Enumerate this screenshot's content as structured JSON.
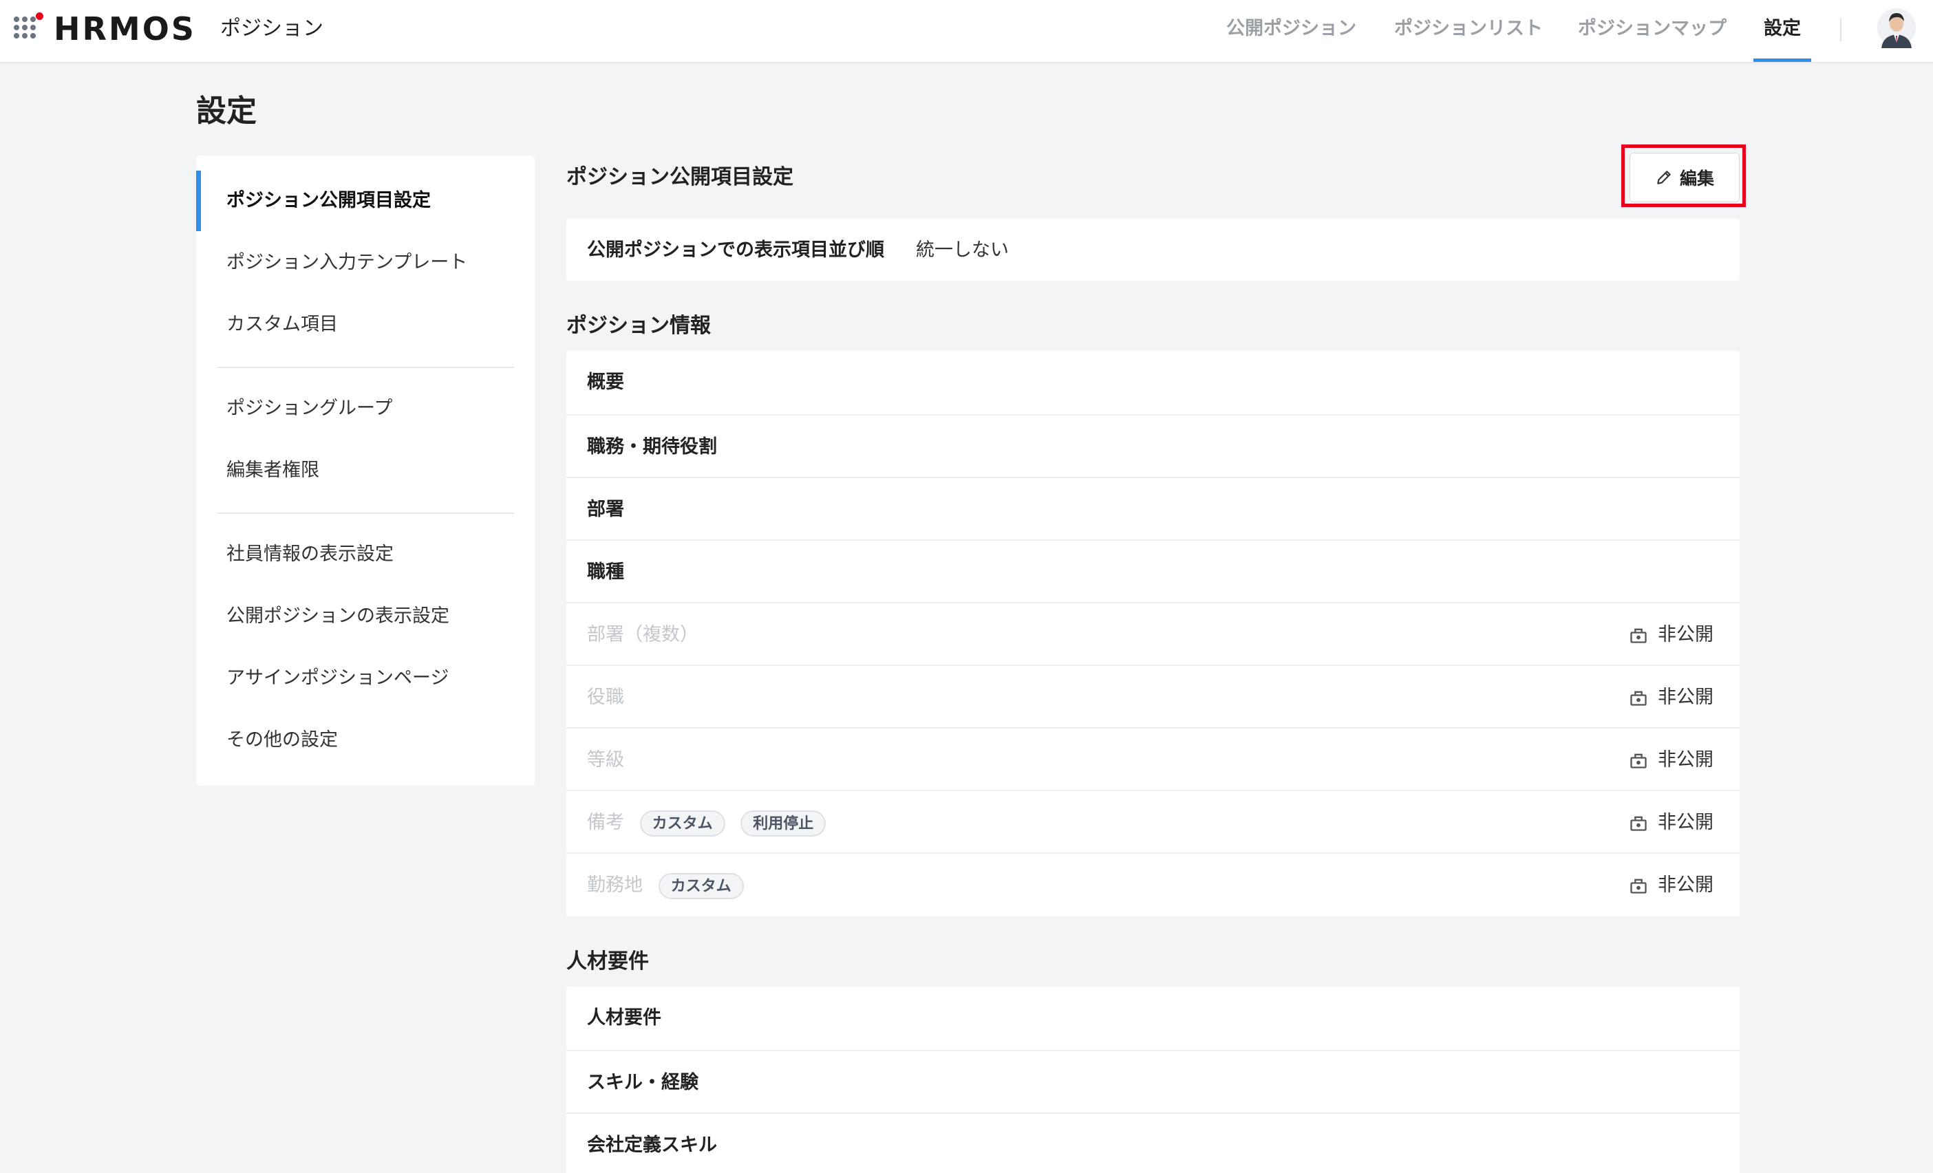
{
  "header": {
    "logo": "HRMOS",
    "app_name": "ポジション",
    "nav": [
      {
        "label": "公開ポジション"
      },
      {
        "label": "ポジションリスト"
      },
      {
        "label": "ポジションマップ"
      },
      {
        "label": "設定"
      }
    ],
    "active_nav": "設定",
    "accent_color": "#2f8fe8"
  },
  "page": {
    "title": "設定"
  },
  "sidebar": {
    "groups": [
      [
        {
          "label": "ポジション公開項目設定"
        },
        {
          "label": "ポジション入力テンプレート"
        },
        {
          "label": "カスタム項目"
        }
      ],
      [
        {
          "label": "ポジショングループ"
        },
        {
          "label": "編集者権限"
        }
      ],
      [
        {
          "label": "社員情報の表示設定"
        },
        {
          "label": "公開ポジションの表示設定"
        },
        {
          "label": "アサインポジションページ"
        },
        {
          "label": "その他の設定"
        }
      ]
    ],
    "active": "ポジション公開項目設定"
  },
  "main": {
    "title": "ポジション公開項目設定",
    "edit_label": "編集",
    "edit_icon": "pencil-icon",
    "order": {
      "label": "公開ポジションでの表示項目並び順",
      "value": "統一しない"
    },
    "sections": [
      {
        "title": "ポジション情報",
        "rows": [
          {
            "label": "概要"
          },
          {
            "label": "職務・期待役割"
          },
          {
            "label": "部署"
          },
          {
            "label": "職種"
          },
          {
            "label": "部署（複数）",
            "status": "非公開"
          },
          {
            "label": "役職",
            "status": "非公開"
          },
          {
            "label": "等級",
            "status": "非公開"
          },
          {
            "label": "備考",
            "tags": [
              "カスタム",
              "利用停止"
            ],
            "status": "非公開"
          },
          {
            "label": "勤務地",
            "tags": [
              "カスタム"
            ],
            "status": "非公開"
          }
        ]
      },
      {
        "title": "人材要件",
        "rows": [
          {
            "label": "人材要件"
          },
          {
            "label": "スキル・経験"
          },
          {
            "label": "会社定義スキル"
          }
        ]
      }
    ],
    "highlight_color": "#e8001c"
  }
}
